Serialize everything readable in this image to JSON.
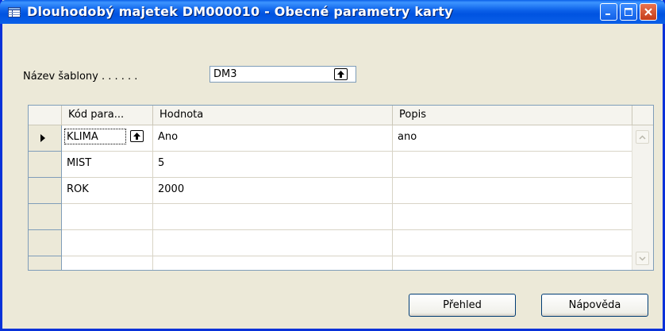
{
  "window": {
    "title": "Dlouhodobý majetek DM000010 - Obecné parametry karty"
  },
  "template": {
    "label": "Název šablony . . . . . .",
    "value": "DM3"
  },
  "grid": {
    "columns": [
      "Kód para...",
      "Hodnota",
      "Popis"
    ],
    "rows": [
      {
        "code": "KLIMA",
        "value": "Ano",
        "description": "ano"
      },
      {
        "code": "MIST",
        "value": "5",
        "description": ""
      },
      {
        "code": "ROK",
        "value": "2000",
        "description": ""
      },
      {
        "code": "",
        "value": "",
        "description": ""
      },
      {
        "code": "",
        "value": "",
        "description": ""
      },
      {
        "code": "",
        "value": "",
        "description": ""
      }
    ]
  },
  "buttons": {
    "overview_label": "Přehled",
    "help_label": "Nápověda"
  },
  "colors": {
    "titlebar": "#0a5fe8",
    "close_button": "#d5562e",
    "window_body": "#ece9d8"
  },
  "icons": {
    "window_icon": "table-icon",
    "lookup": "lookup-arrow-icon"
  }
}
